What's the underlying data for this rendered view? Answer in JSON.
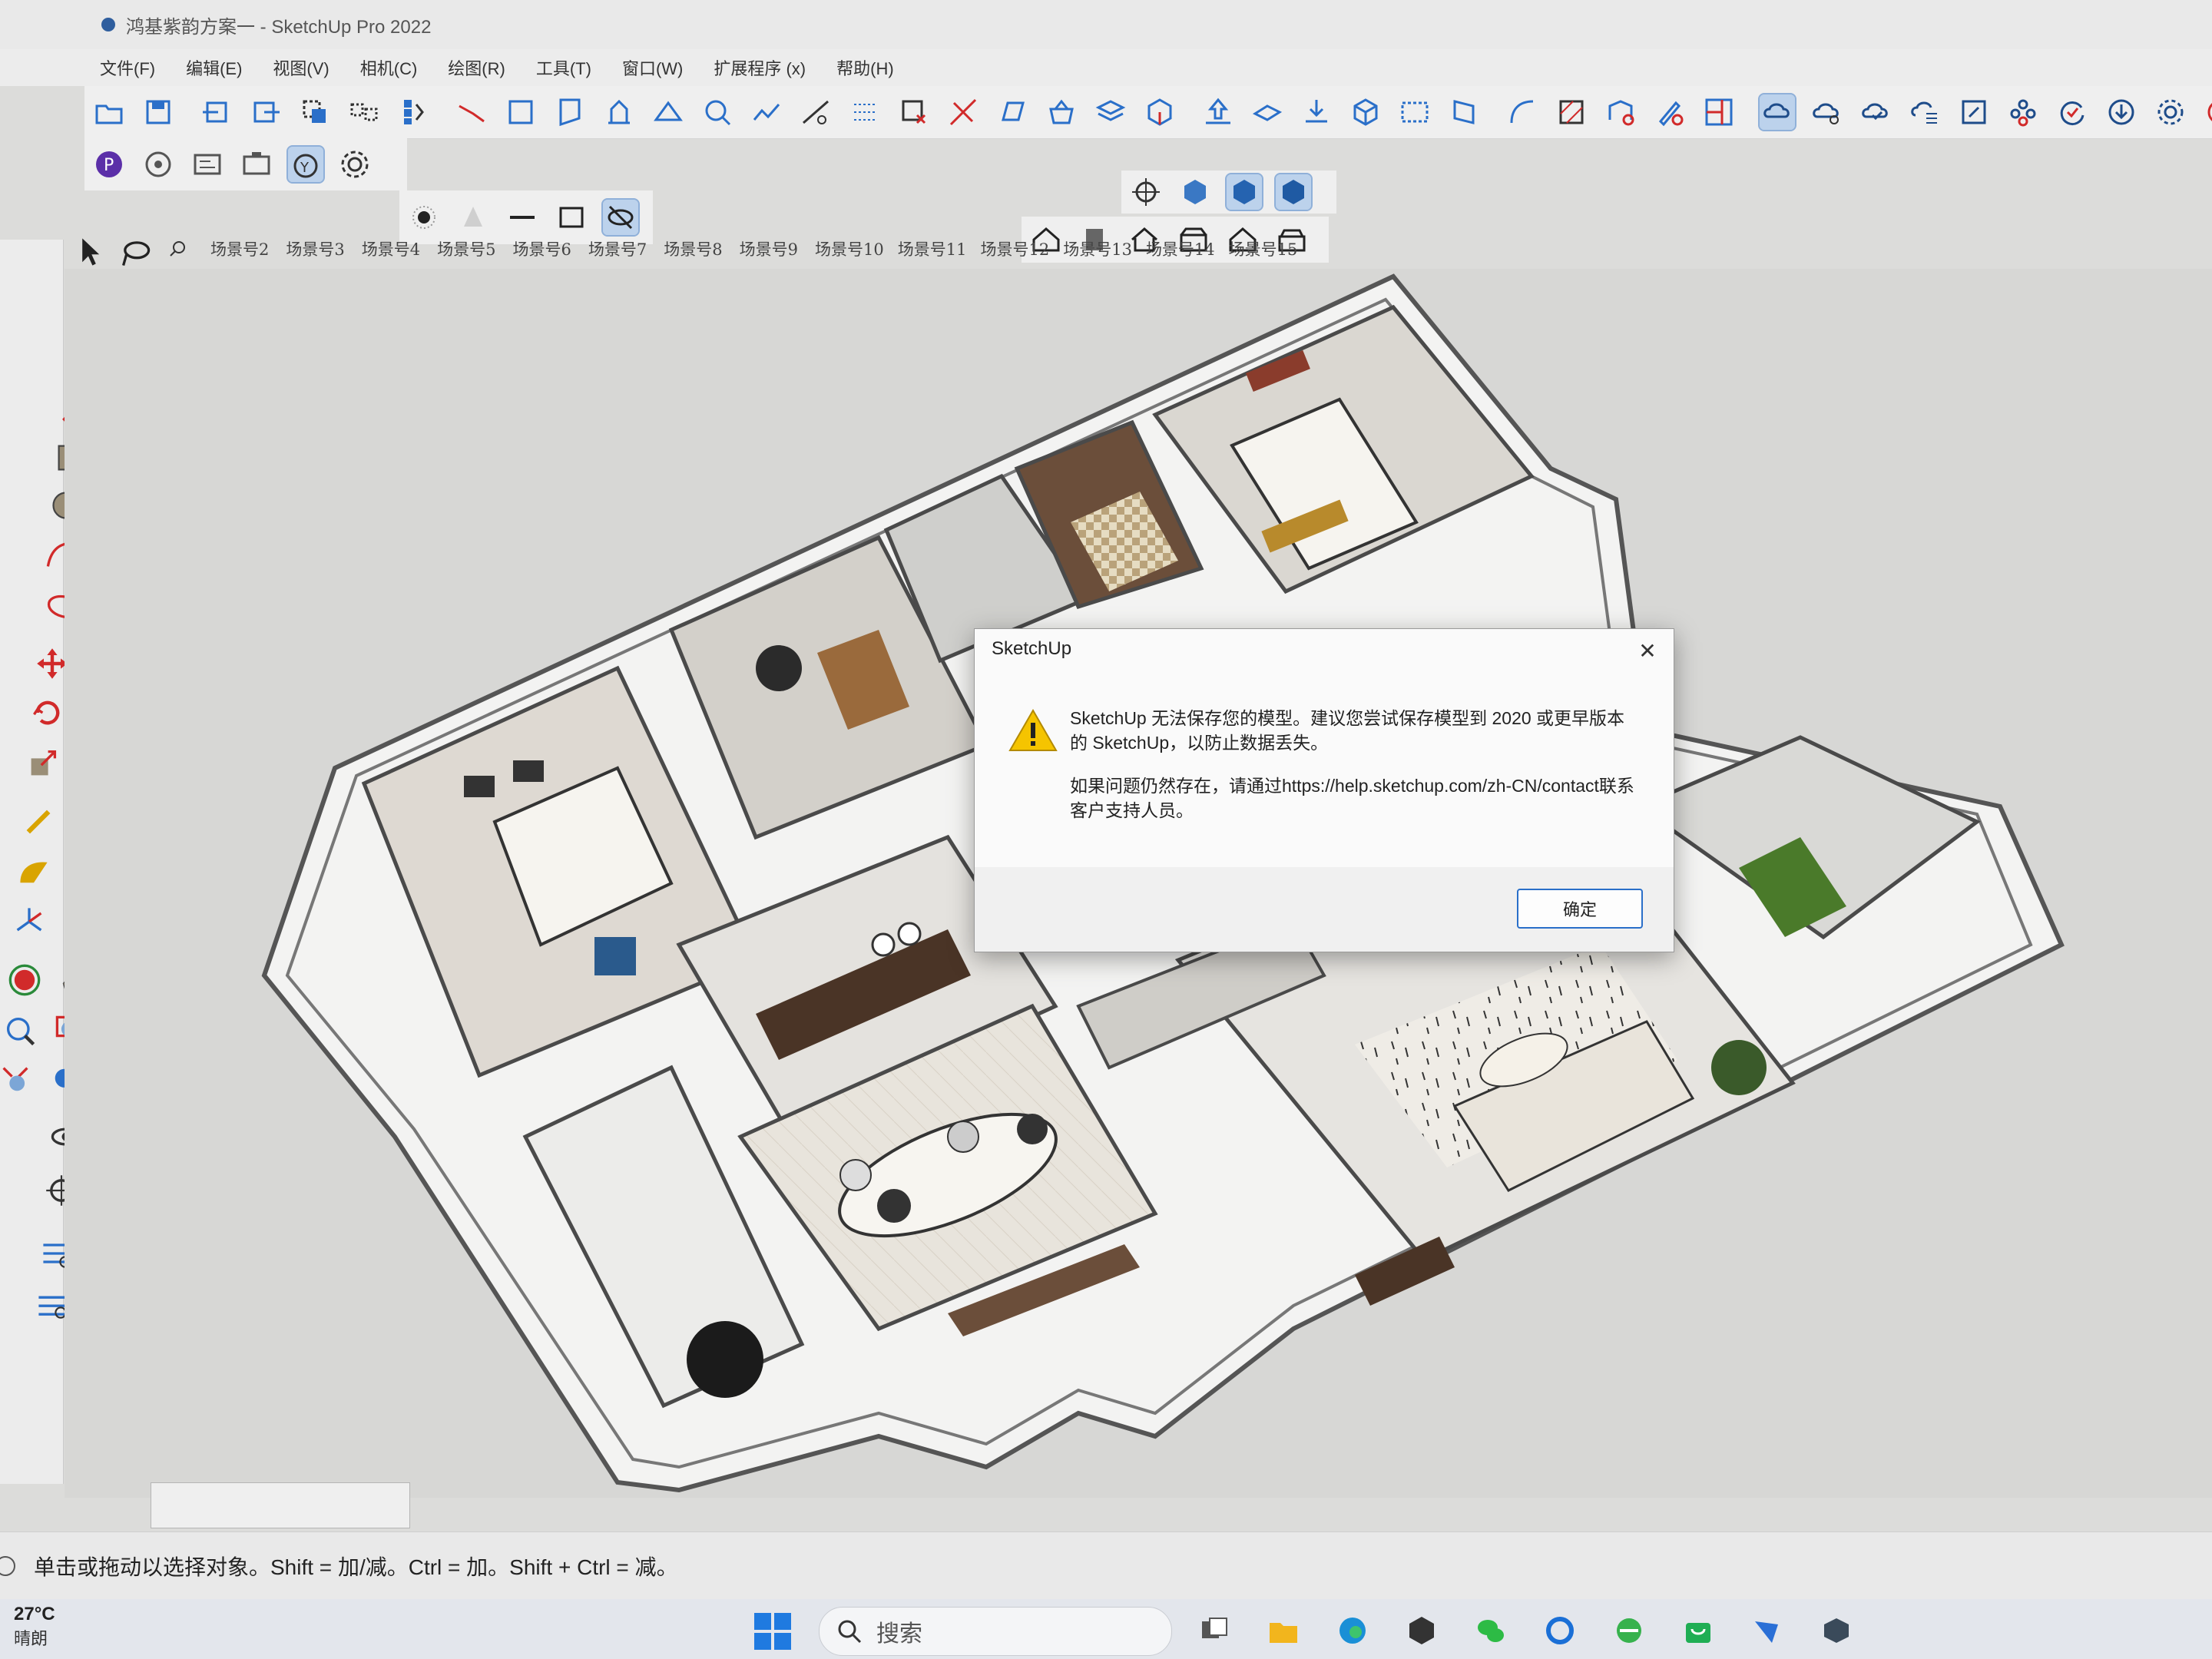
{
  "window": {
    "title": "鸿基紫韵方案一 - SketchUp Pro 2022"
  },
  "menu": [
    "文件(F)",
    "编辑(E)",
    "视图(V)",
    "相机(C)",
    "绘图(R)",
    "工具(T)",
    "窗口(W)",
    "扩展程序 (x)",
    "帮助(H)"
  ],
  "scenes": [
    "场景号2",
    "场景号3",
    "场景号4",
    "场景号5",
    "场景号6",
    "场景号7",
    "场景号8",
    "场景号9",
    "场景号10",
    "场景号11",
    "场景号12",
    "场景号13",
    "场景号14",
    "场景号15"
  ],
  "dialog": {
    "title": "SketchUp",
    "close_label": "✕",
    "message_line1": "SketchUp 无法保存您的模型。建议您尝试保存模型到 2020 或更早版本的 SketchUp，以防止数据丢失。",
    "message_line2": "如果问题仍然存在，请通过https://help.sketchup.com/zh-CN/contact联系客户支持人员。",
    "ok_label": "确定"
  },
  "status": {
    "hint": "单击或拖动以选择对象。Shift = 加/减。Ctrl = 加。Shift + Ctrl = 减。"
  },
  "taskbar": {
    "weather_temp": "27°C",
    "weather_cond": "晴朗",
    "search_placeholder": "搜索"
  },
  "colors": {
    "accent": "#2a6fc9",
    "warning": "#f5c400",
    "toolbar_active": "#bcd2ec"
  }
}
